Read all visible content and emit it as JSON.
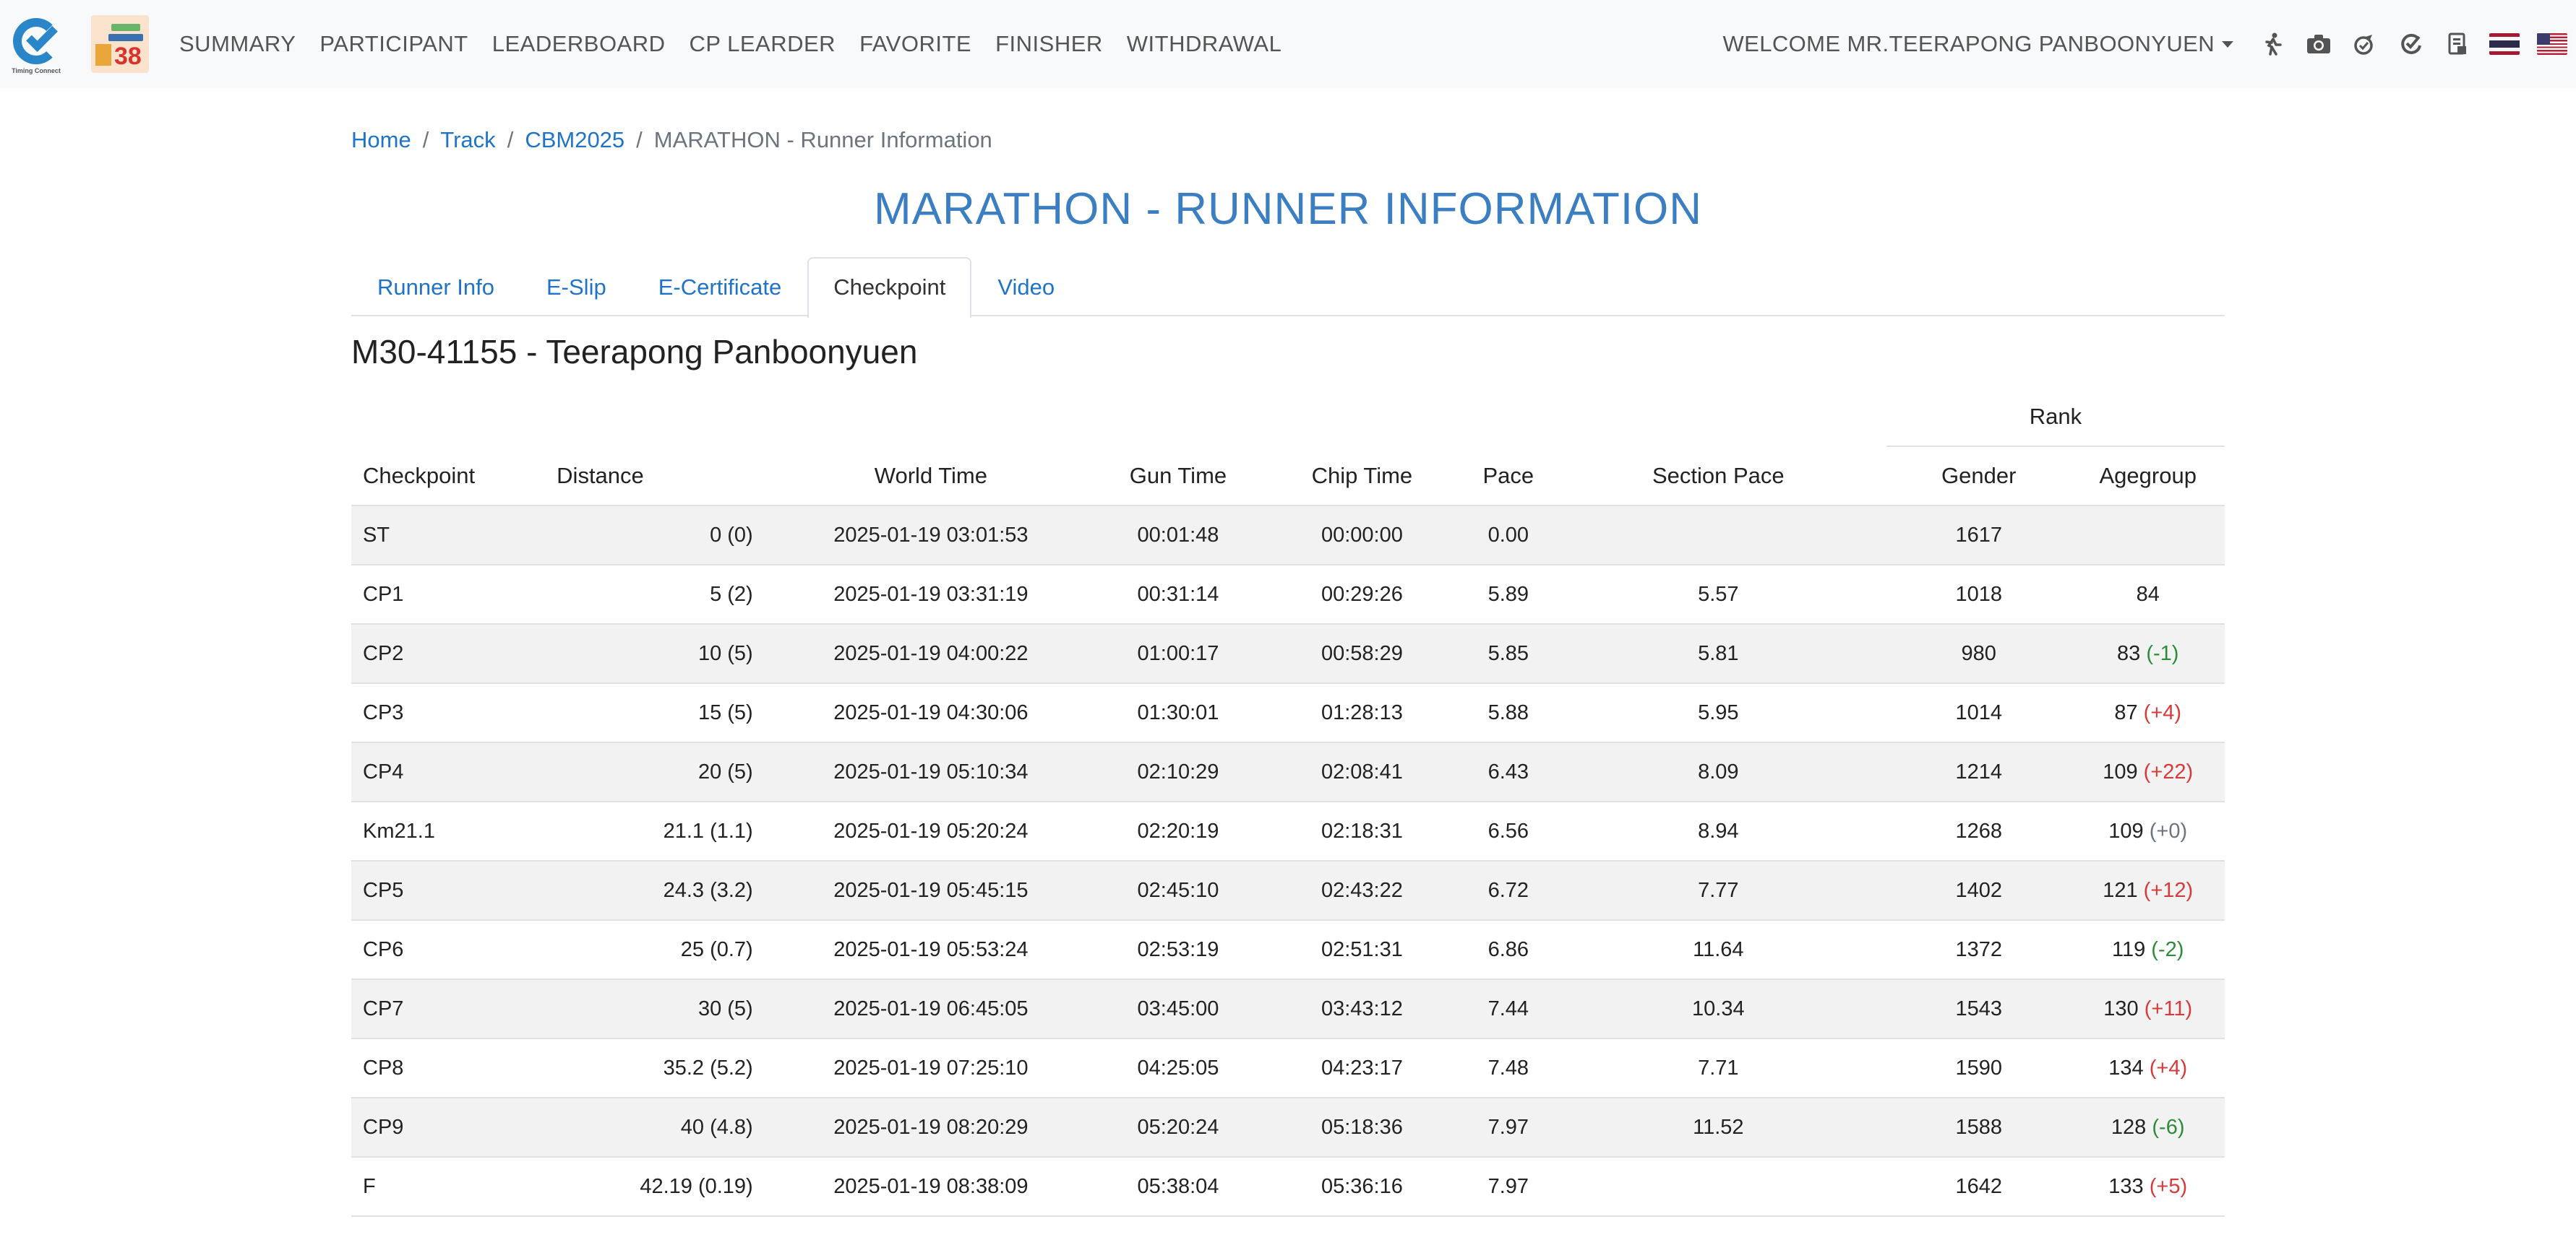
{
  "nav": {
    "links": [
      "SUMMARY",
      "PARTICIPANT",
      "LEADERBOARD",
      "CP LEARDER",
      "FAVORITE",
      "FINISHER",
      "WITHDRAWAL"
    ],
    "welcome": "WELCOME MR.TEERAPONG PANBOONYUEN",
    "logo_caption": "Timing Connect",
    "event_logo_number": "38",
    "icons": [
      "runner-icon",
      "camera-icon",
      "medal-icon",
      "timing-connect-icon",
      "certificate-icon",
      "flag-thailand-icon",
      "flag-usa-icon"
    ]
  },
  "breadcrumb": {
    "items": [
      "Home",
      "Track",
      "CBM2025"
    ],
    "active": "MARATHON - Runner Information"
  },
  "page_title": "MARATHON - RUNNER INFORMATION",
  "tabs": [
    {
      "label": "Runner Info",
      "active": false
    },
    {
      "label": "E-Slip",
      "active": false
    },
    {
      "label": "E-Certificate",
      "active": false
    },
    {
      "label": "Checkpoint",
      "active": true
    },
    {
      "label": "Video",
      "active": false
    }
  ],
  "runner": {
    "title": "M30-41155 - Teerapong Panboonyuen"
  },
  "table": {
    "rank_header": "Rank",
    "headers": {
      "checkpoint": "Checkpoint",
      "distance": "Distance",
      "world_time": "World Time",
      "gun_time": "Gun Time",
      "chip_time": "Chip Time",
      "pace": "Pace",
      "section_pace": "Section Pace",
      "gender": "Gender",
      "agegroup": "Agegroup"
    },
    "rows": [
      {
        "checkpoint": "ST",
        "distance": "0 (0)",
        "world_time": "2025-01-19 03:01:53",
        "gun_time": "00:01:48",
        "chip_time": "00:00:00",
        "pace": "0.00",
        "section_pace": "",
        "gender": "1617",
        "agegroup": "",
        "change": "",
        "change_type": ""
      },
      {
        "checkpoint": "CP1",
        "distance": "5 (2)",
        "world_time": "2025-01-19 03:31:19",
        "gun_time": "00:31:14",
        "chip_time": "00:29:26",
        "pace": "5.89",
        "section_pace": "5.57",
        "gender": "1018",
        "agegroup": "84",
        "change": "",
        "change_type": ""
      },
      {
        "checkpoint": "CP2",
        "distance": "10 (5)",
        "world_time": "2025-01-19 04:00:22",
        "gun_time": "01:00:17",
        "chip_time": "00:58:29",
        "pace": "5.85",
        "section_pace": "5.81",
        "gender": "980",
        "agegroup": "83",
        "change": "(-1)",
        "change_type": "neg"
      },
      {
        "checkpoint": "CP3",
        "distance": "15 (5)",
        "world_time": "2025-01-19 04:30:06",
        "gun_time": "01:30:01",
        "chip_time": "01:28:13",
        "pace": "5.88",
        "section_pace": "5.95",
        "gender": "1014",
        "agegroup": "87",
        "change": "(+4)",
        "change_type": "pos"
      },
      {
        "checkpoint": "CP4",
        "distance": "20 (5)",
        "world_time": "2025-01-19 05:10:34",
        "gun_time": "02:10:29",
        "chip_time": "02:08:41",
        "pace": "6.43",
        "section_pace": "8.09",
        "gender": "1214",
        "agegroup": "109",
        "change": "(+22)",
        "change_type": "pos"
      },
      {
        "checkpoint": "Km21.1",
        "distance": "21.1 (1.1)",
        "world_time": "2025-01-19 05:20:24",
        "gun_time": "02:20:19",
        "chip_time": "02:18:31",
        "pace": "6.56",
        "section_pace": "8.94",
        "gender": "1268",
        "agegroup": "109",
        "change": "(+0)",
        "change_type": "zero"
      },
      {
        "checkpoint": "CP5",
        "distance": "24.3 (3.2)",
        "world_time": "2025-01-19 05:45:15",
        "gun_time": "02:45:10",
        "chip_time": "02:43:22",
        "pace": "6.72",
        "section_pace": "7.77",
        "gender": "1402",
        "agegroup": "121",
        "change": "(+12)",
        "change_type": "pos"
      },
      {
        "checkpoint": "CP6",
        "distance": "25 (0.7)",
        "world_time": "2025-01-19 05:53:24",
        "gun_time": "02:53:19",
        "chip_time": "02:51:31",
        "pace": "6.86",
        "section_pace": "11.64",
        "gender": "1372",
        "agegroup": "119",
        "change": "(-2)",
        "change_type": "neg"
      },
      {
        "checkpoint": "CP7",
        "distance": "30 (5)",
        "world_time": "2025-01-19 06:45:05",
        "gun_time": "03:45:00",
        "chip_time": "03:43:12",
        "pace": "7.44",
        "section_pace": "10.34",
        "gender": "1543",
        "agegroup": "130",
        "change": "(+11)",
        "change_type": "pos"
      },
      {
        "checkpoint": "CP8",
        "distance": "35.2 (5.2)",
        "world_time": "2025-01-19 07:25:10",
        "gun_time": "04:25:05",
        "chip_time": "04:23:17",
        "pace": "7.48",
        "section_pace": "7.71",
        "gender": "1590",
        "agegroup": "134",
        "change": "(+4)",
        "change_type": "pos"
      },
      {
        "checkpoint": "CP9",
        "distance": "40 (4.8)",
        "world_time": "2025-01-19 08:20:29",
        "gun_time": "05:20:24",
        "chip_time": "05:18:36",
        "pace": "7.97",
        "section_pace": "11.52",
        "gender": "1588",
        "agegroup": "128",
        "change": "(-6)",
        "change_type": "neg"
      },
      {
        "checkpoint": "F",
        "distance": "42.19 (0.19)",
        "world_time": "2025-01-19 08:38:09",
        "gun_time": "05:38:04",
        "chip_time": "05:36:16",
        "pace": "7.97",
        "section_pace": "",
        "gender": "1642",
        "agegroup": "133",
        "change": "(+5)",
        "change_type": "pos"
      }
    ]
  },
  "colors": {
    "link": "#1f73c9",
    "title": "#3b7ec2",
    "rank_improve": "#2e8b3a",
    "rank_drop": "#d63a3a",
    "rank_same": "#6c757d"
  }
}
